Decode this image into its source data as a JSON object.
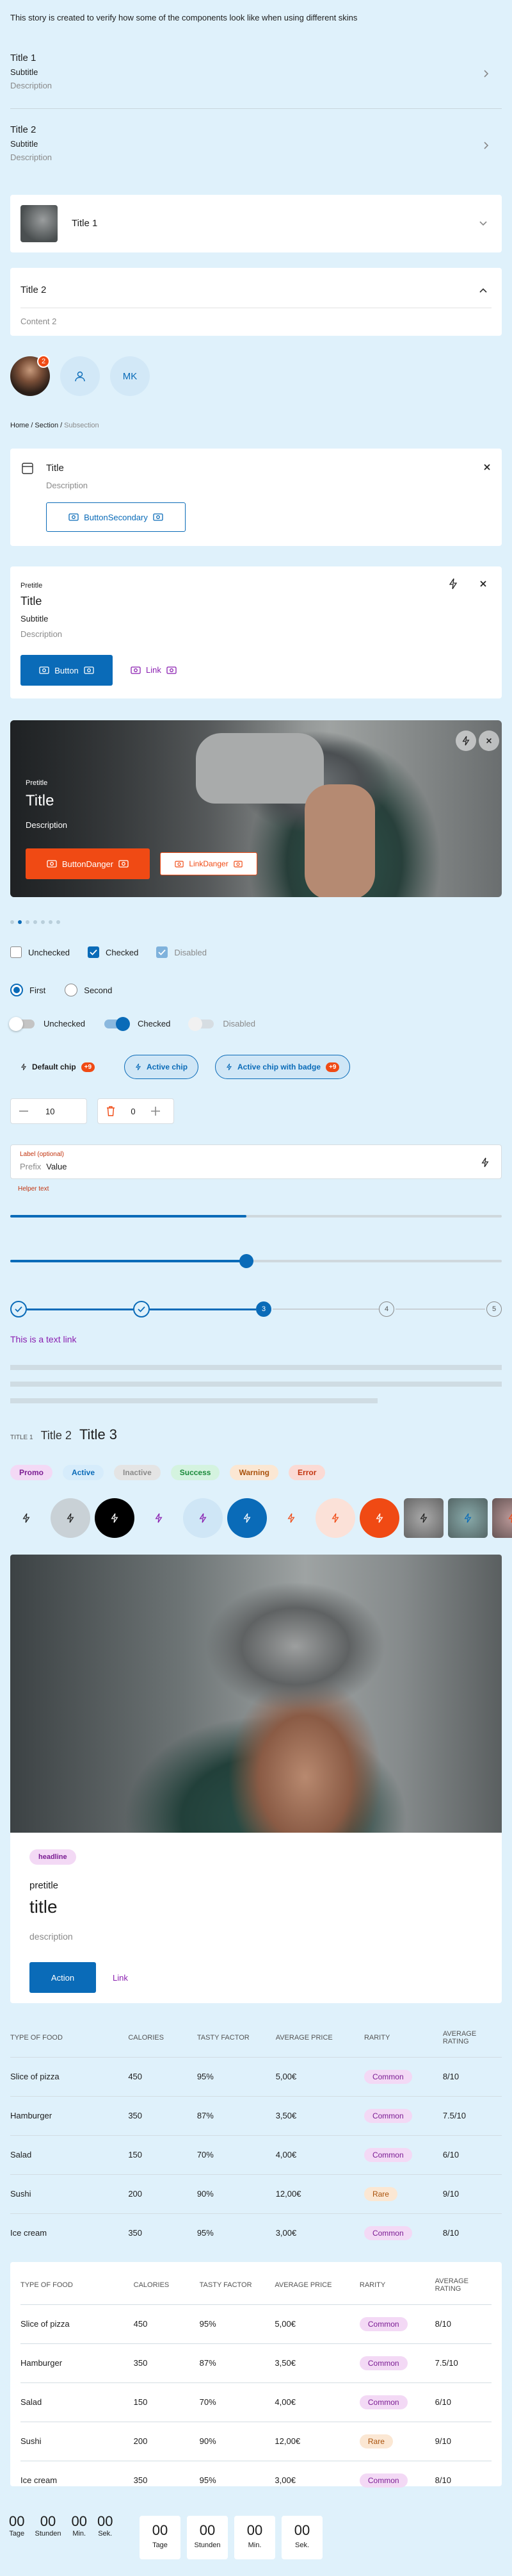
{
  "intro": "This story is created to verify how some of the components look like when using different skins",
  "list": [
    {
      "title": "Title 1",
      "subtitle": "Subtitle",
      "description": "Description"
    },
    {
      "title": "Title 2",
      "subtitle": "Subtitle",
      "description": "Description"
    }
  ],
  "accordion": {
    "item1_title": "Title 1",
    "item2_title": "Title 2",
    "item2_content": "Content 2"
  },
  "avatars": {
    "badge_count": "2",
    "initials": "MK"
  },
  "breadcrumb": {
    "home": "Home",
    "section": "Section",
    "sub": "Subsection",
    "sep": "/"
  },
  "info_card": {
    "title": "Title",
    "description": "Description",
    "button": "ButtonSecondary"
  },
  "media_card": {
    "pretitle": "Pretitle",
    "title": "Title",
    "subtitle": "Subtitle",
    "description": "Description",
    "button": "Button",
    "link": "Link"
  },
  "hero": {
    "pretitle": "Pretitle",
    "title": "Title",
    "description": "Description",
    "button": "ButtonDanger",
    "link": "LinkDanger"
  },
  "checkboxes": {
    "unchecked": "Unchecked",
    "checked": "Checked",
    "disabled": "Disabled"
  },
  "radios": {
    "first": "First",
    "second": "Second"
  },
  "switches": {
    "unchecked": "Unchecked",
    "checked": "Checked",
    "disabled": "Disabled"
  },
  "chips": {
    "default": "Default chip",
    "default_badge": "+9",
    "active": "Active chip",
    "active_badge_label": "Active chip with badge",
    "active_badge": "+9"
  },
  "steppers": {
    "value1": "10",
    "value2": "0"
  },
  "text_field": {
    "label": "Label (optional)",
    "prefix": "Prefix",
    "value": "Value",
    "helper": "Helper text"
  },
  "progress": {
    "value": 0.48
  },
  "slider": {
    "value": 0.48
  },
  "step_indicator": {
    "step3": "3",
    "step4": "4",
    "step5": "5",
    "current": 3
  },
  "text_link": "This is a text link",
  "titles": {
    "t1": "TITLE 1",
    "t2": "Title 2",
    "t3": "Title 3"
  },
  "tags": [
    {
      "label": "Promo",
      "bg": "#f3d9f5",
      "fg": "#7b1d93"
    },
    {
      "label": "Active",
      "bg": "#d6ecfb",
      "fg": "#0a6bb8"
    },
    {
      "label": "Inactive",
      "bg": "#e4e4e4",
      "fg": "#8a8a8a"
    },
    {
      "label": "Success",
      "bg": "#d4f3df",
      "fg": "#1b8a3a"
    },
    {
      "label": "Warning",
      "bg": "#fbe7d3",
      "fg": "#a9520b"
    },
    {
      "label": "Error",
      "bg": "#fbdad4",
      "fg": "#c2330e"
    }
  ],
  "poster": {
    "headline": "headline",
    "pretitle": "pretitle",
    "title": "title",
    "description": "description",
    "button": "Action",
    "link": "Link"
  },
  "table": {
    "headers": [
      "TYPE OF FOOD",
      "CALORIES",
      "TASTY FACTOR",
      "AVERAGE PRICE",
      "RARITY",
      "AVERAGE RATING"
    ],
    "rows": [
      [
        "Slice of pizza",
        "450",
        "95%",
        "5,00€",
        "Common",
        "8/10"
      ],
      [
        "Hamburger",
        "350",
        "87%",
        "3,50€",
        "Common",
        "7.5/10"
      ],
      [
        "Salad",
        "150",
        "70%",
        "4,00€",
        "Common",
        "6/10"
      ],
      [
        "Sushi",
        "200",
        "90%",
        "12,00€",
        "Rare",
        "9/10"
      ],
      [
        "Ice cream",
        "350",
        "95%",
        "3,00€",
        "Common",
        "8/10"
      ]
    ]
  },
  "countdown": {
    "value": "00",
    "labels": [
      "Tage",
      "Stunden",
      "Min.",
      "Sek."
    ]
  },
  "colors": {
    "brand": "#0a6bb8",
    "danger": "#f04a14",
    "background": "#dff1fb"
  }
}
